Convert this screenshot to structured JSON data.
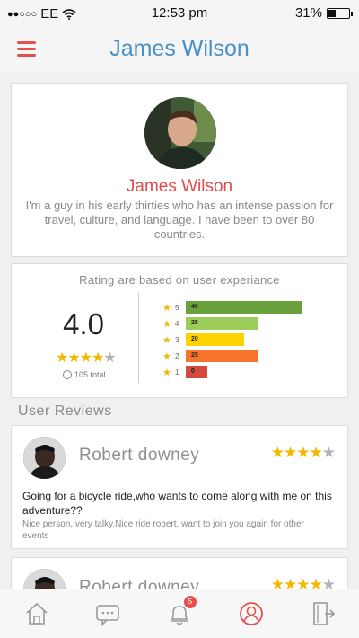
{
  "status_bar": {
    "carrier": "EE",
    "signal": "●●○○○",
    "time": "12:53 pm",
    "battery": "31%"
  },
  "header": {
    "title": "James Wilson",
    "menu_icon": "hamburger-icon"
  },
  "profile": {
    "name": "James Wilson",
    "bio": "I'm a guy in his early thirties who has an intense passion for travel, culture, and language. I have been to over 80 countries."
  },
  "rating": {
    "caption": "Rating are based on user experiance",
    "score": "4.0",
    "stars": 4,
    "total": "105 total",
    "breakdown": [
      {
        "star": "5",
        "count": "40",
        "color": "#6aa13c"
      },
      {
        "star": "4",
        "count": "25",
        "color": "#9ccc5a"
      },
      {
        "star": "3",
        "count": "20",
        "color": "#ffd200"
      },
      {
        "star": "2",
        "count": "25",
        "color": "#f7742a"
      },
      {
        "star": "1",
        "count": "0",
        "color": "#d44a3c"
      }
    ]
  },
  "reviews_section": {
    "title": "User Reviews"
  },
  "reviews": [
    {
      "name": "Robert downey",
      "stars": 4,
      "title": "Going for a bicycle ride,who wants to come along with me on this adventure??",
      "text": "Nice person, very talky,Nice ride robert, want to join you again for other events"
    },
    {
      "name": "Robert downey",
      "stars": 4
    }
  ],
  "tab_bar": {
    "items": [
      "home-icon",
      "chat-icon",
      "bell-icon",
      "profile-icon",
      "logout-icon"
    ],
    "notification_count": "5",
    "active": "profile-icon",
    "active_color": "#e94e4e"
  }
}
